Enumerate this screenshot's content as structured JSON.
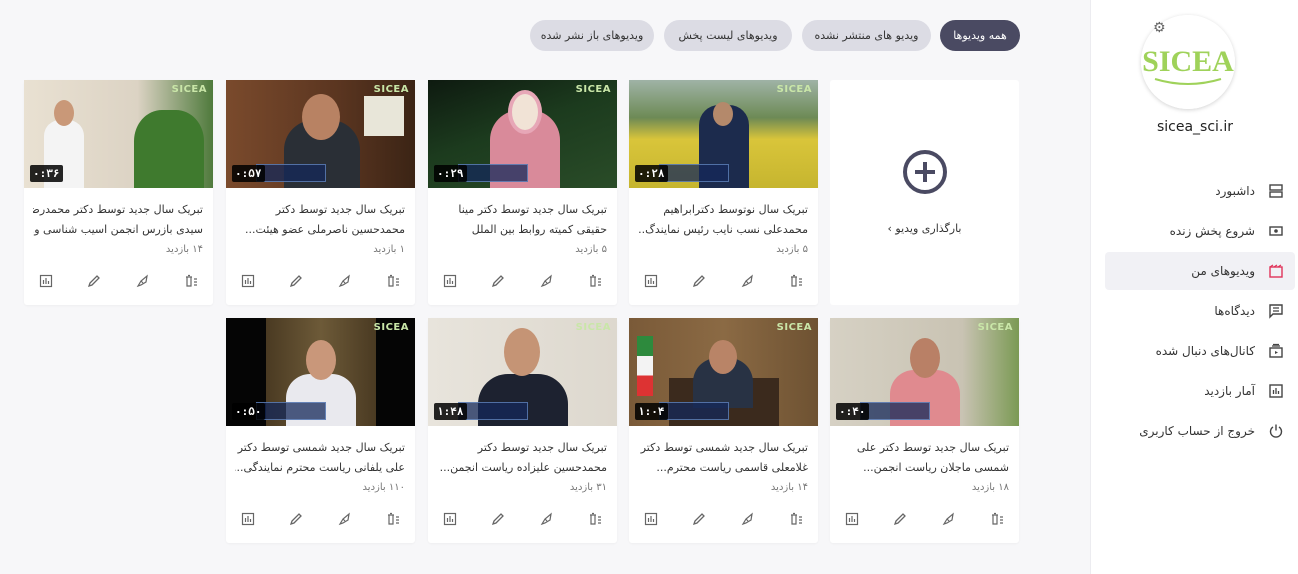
{
  "filters": [
    {
      "label": "همه ویدیوها",
      "active": true
    },
    {
      "label": "ویدیو های منتشر نشده",
      "active": false
    },
    {
      "label": "ویدیوهای لیست پخش",
      "active": false
    },
    {
      "label": "ویدیوهای باز نشر شده",
      "active": false
    }
  ],
  "upload": {
    "label": "بارگذاری ویدیو  ›"
  },
  "videos": [
    {
      "line1": "تبریک سال نوتوسط دکترابراهیم",
      "line2": "محمدعلی نسب نایب رئیس نمایندگ...",
      "views": "۵ بازدید",
      "duration": "۰:۲۸"
    },
    {
      "line1": "تبریک سال جدید توسط دکتر مینا",
      "line2": "حقیقی کمیته روابط بین الملل",
      "views": "۵ بازدید",
      "duration": "۰:۲۹"
    },
    {
      "line1": "تبریک سال جدید توسط دکتر",
      "line2": "محمدحسین ناصرملی عضو هیئت...",
      "views": "۱ بازدید",
      "duration": "۰:۵۷"
    },
    {
      "line1": "تبریک سال جدید توسط دکتر محمدرضا",
      "line2": "سیدی بازرس انجمن اسیب شناسی و...",
      "views": "۱۴ بازدید",
      "duration": "۰:۳۶"
    },
    {
      "line1": "تبریک سال جدید توسط دکتر علی",
      "line2": "شمسی ماجلان ریاست انجمن...",
      "views": "۱۸ بازدید",
      "duration": "۰:۴۰"
    },
    {
      "line1": "تبریک سال جدید شمسی توسط دکتر",
      "line2": "غلامعلی قاسمی ریاست محترم...",
      "views": "۱۴ بازدید",
      "duration": "۱:۰۴"
    },
    {
      "line1": "تبریک سال جدید توسط دکتر",
      "line2": "محمدحسین علیزاده ریاست انجمن...",
      "views": "۳۱ بازدید",
      "duration": "۱:۴۸"
    },
    {
      "line1": "تبریک سال جدید شمسی توسط دکتر",
      "line2": "علی یلفانی ریاست محترم نمایندگی...",
      "views": "۱۱۰ بازدید",
      "duration": "۰:۵۰"
    }
  ],
  "thumb_logo": "SICEA",
  "sidebar": {
    "logo_text": "SICEA",
    "channel": "sicea_sci.ir",
    "items": [
      {
        "label": "داشبورد",
        "icon": "dashboard-icon"
      },
      {
        "label": "شروع پخش زنده",
        "icon": "live-icon"
      },
      {
        "label": "ویدیوهای من",
        "icon": "videos-icon"
      },
      {
        "label": "دیدگاه‌ها",
        "icon": "comments-icon"
      },
      {
        "label": "کانال‌های دنبال شده",
        "icon": "subscriptions-icon"
      },
      {
        "label": "آمار بازدید",
        "icon": "stats-icon"
      },
      {
        "label": "خروج از حساب کاربری",
        "icon": "logout-icon"
      }
    ]
  }
}
